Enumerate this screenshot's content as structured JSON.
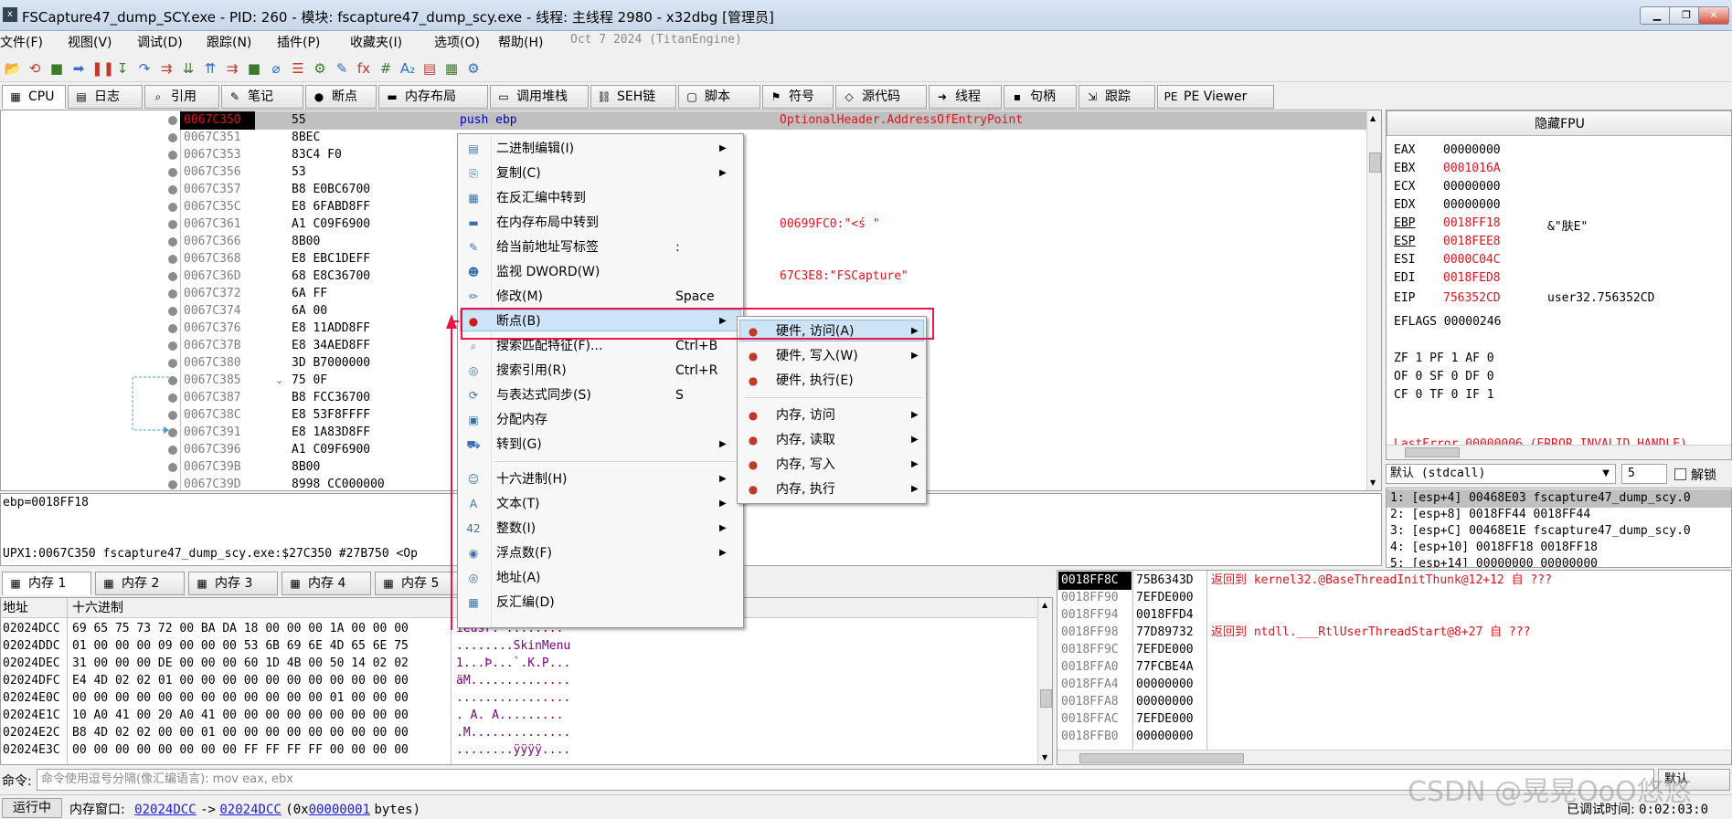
{
  "window": {
    "title": "FSCapture47_dump_SCY.exe - PID: 260 - 模块: fscapture47_dump_scy.exe - 线程: 主线程 2980 - x32dbg [管理员]",
    "min": "▁",
    "max": "❐",
    "close": "✕"
  },
  "menubar": {
    "items": [
      "文件(F)",
      "视图(V)",
      "调试(D)",
      "跟踪(N)",
      "插件(P)",
      "收藏夹(I)",
      "选项(O)",
      "帮助(H)"
    ],
    "build": "Oct 7 2024 (TitanEngine)"
  },
  "toolbar": {
    "icons": [
      "📂",
      "⟲",
      "■",
      "➡",
      "❚❚",
      "↧",
      "↷",
      "⇉",
      "⇊",
      "⇈",
      "⇉",
      "■",
      "⌀",
      "☰",
      "⚙",
      "✎",
      "fx",
      "#",
      "A₂",
      "▤",
      "▦",
      "⚙"
    ]
  },
  "tabs": [
    "CPU",
    "日志",
    "引用",
    "笔记",
    "断点",
    "内存布局",
    "调用堆栈",
    "SEH链",
    "脚本",
    "符号",
    "源代码",
    "线程",
    "句柄",
    "跟踪",
    "PE Viewer"
  ],
  "tab_icons": [
    "▦",
    "▤",
    "⌕",
    "✎",
    "●",
    "▬",
    "▭",
    "⛓",
    "▢",
    "⚑",
    "◇",
    "➜",
    "▪",
    "⇲",
    "PE"
  ],
  "disasm": {
    "rows": [
      {
        "addr": "0067C350",
        "bytes": "55",
        "asm": "push ebp",
        "comment": "OptionalHeader.AddressOfEntryPoint"
      },
      {
        "addr": "0067C351",
        "bytes": "8BEC",
        "asm": "",
        "comment": ""
      },
      {
        "addr": "0067C353",
        "bytes": "83C4 F0",
        "asm": "",
        "comment": ""
      },
      {
        "addr": "0067C356",
        "bytes": "53",
        "asm": "",
        "comment": ""
      },
      {
        "addr": "0067C357",
        "bytes": "B8 E0BC6700",
        "asm": "",
        "comment": ""
      },
      {
        "addr": "0067C35C",
        "bytes": "E8 6FABD8FF",
        "asm": "",
        "comment": ""
      },
      {
        "addr": "0067C361",
        "bytes": "A1 C09F6900",
        "asm": "",
        "comment": "00699FC0:\"<ś \""
      },
      {
        "addr": "0067C366",
        "bytes": "8B00",
        "asm": "",
        "comment": ""
      },
      {
        "addr": "0067C368",
        "bytes": "E8 EBC1DEFF",
        "asm": "",
        "comment": ""
      },
      {
        "addr": "0067C36D",
        "bytes": "68 E8C36700",
        "asm": "",
        "comment": "67C3E8:\"FSCapture\""
      },
      {
        "addr": "0067C372",
        "bytes": "6A FF",
        "asm": "",
        "comment": ""
      },
      {
        "addr": "0067C374",
        "bytes": "6A 00",
        "asm": "",
        "comment": ""
      },
      {
        "addr": "0067C376",
        "bytes": "E8 11ADD8FF",
        "asm": "",
        "comment": ""
      },
      {
        "addr": "0067C37B",
        "bytes": "E8 34AED8FF",
        "asm": "",
        "comment": ""
      },
      {
        "addr": "0067C380",
        "bytes": "3D B7000000",
        "asm": "",
        "comment": ""
      },
      {
        "addr": "0067C385",
        "bytes": "75 0F",
        "asm": "",
        "comment": ""
      },
      {
        "addr": "0067C387",
        "bytes": "B8 FCC36700",
        "asm": "",
        "comment": ""
      },
      {
        "addr": "0067C38C",
        "bytes": "E8 53F8FFFF",
        "asm": "",
        "comment": ""
      },
      {
        "addr": "0067C391",
        "bytes": "E8 1A83D8FF",
        "asm": "",
        "comment": ""
      },
      {
        "addr": "0067C396",
        "bytes": "A1 C09F6900",
        "asm": "",
        "comment": ""
      },
      {
        "addr": "0067C39B",
        "bytes": "8B00",
        "asm": "",
        "comment": ""
      },
      {
        "addr": "0067C39D",
        "bytes": "8998 CC000000",
        "asm": "",
        "comment": ""
      }
    ],
    "jump_marker": "⌄"
  },
  "info": {
    "line1": "ebp=0018FF18",
    "line2": "UPX1:0067C350 fscapture47_dump_scy.exe:$27C350 #27B750 <Op"
  },
  "fpu": {
    "toggle": "隐藏FPU",
    "regs": [
      {
        "n": "EAX",
        "v": "00000000",
        "x": ""
      },
      {
        "n": "EBX",
        "v": "0001016A",
        "x": ""
      },
      {
        "n": "ECX",
        "v": "00000000",
        "x": ""
      },
      {
        "n": "EDX",
        "v": "00000000",
        "x": ""
      },
      {
        "n": "EBP",
        "v": "0018FF18",
        "x": "&\"肤E\""
      },
      {
        "n": "ESP",
        "v": "0018FEE8",
        "x": ""
      },
      {
        "n": "ESI",
        "v": "0000C04C",
        "x": ""
      },
      {
        "n": "EDI",
        "v": "0018FED8",
        "x": ""
      }
    ],
    "eip": {
      "n": "EIP",
      "v": "756352CD",
      "x": "user32.756352CD"
    },
    "eflags": "EFLAGS   00000246",
    "flags": [
      "ZF 1  PF 1  AF 0",
      "OF 0  SF 0  DF 0",
      "CF 0  TF 0  IF 1"
    ],
    "lasterror": "LastError  00000006 (ERROR_INVALID_HANDLE)",
    "callconv": "默认 (stdcall)",
    "argcount": "5",
    "unlock": "解锁",
    "args": [
      "1: [esp+4] 00468E03 fscapture47_dump_scy.0",
      "2: [esp+8] 0018FF44 0018FF44",
      "3: [esp+C] 00468E1E fscapture47_dump_scy.0",
      "4: [esp+10] 0018FF18 0018FF18",
      "5: [esp+14] 00000000 00000000"
    ]
  },
  "dump": {
    "tabs": [
      "内存 1",
      "内存 2",
      "内存 3",
      "内存 4",
      "内存 5"
    ],
    "hdr_addr": "地址",
    "hdr_hex": "十六进制",
    "rows": [
      {
        "a": "02024DCC",
        "h": "69 65 75 73 72 00 BA DA 18 00 00 00 1A 00 00 00",
        "s": "ieusr.  ........"
      },
      {
        "a": "02024DDC",
        "h": "01 00 00 00 09 00 00 00 53 6B 69 6E 4D 65 6E 75",
        "s": "........SkinMenu"
      },
      {
        "a": "02024DEC",
        "h": "31 00 00 00 DE 00 00 00 60 1D 4B 00 50 14 02 02",
        "s": "1...Þ...`.K.P..."
      },
      {
        "a": "02024DFC",
        "h": "E4 4D 02 02 01 00 00 00 00 00 00 00 00 00 00 00",
        "s": "äM.............."
      },
      {
        "a": "02024E0C",
        "h": "00 00 00 00 00 00 00 00 00 00 00 00 01 00 00 00",
        "s": "................"
      },
      {
        "a": "02024E1C",
        "h": "10 A0 41 00 20 A0 41 00 00 00 00 00 00 00 00 00",
        "s": ". A.  A........."
      },
      {
        "a": "02024E2C",
        "h": "B8 4D 02 02 00 00 01 00 00 00 00 00 00 00 00 00",
        "s": ".M.............."
      },
      {
        "a": "02024E3C",
        "h": "00 00 00 00 00 00 00 00 FF FF FF FF 00 00 00 00",
        "s": "........ÿÿÿÿ...."
      }
    ]
  },
  "stack": {
    "rows": [
      {
        "a": "0018FF8C",
        "v": "75B6343D",
        "c": "返回到 kernel32.@BaseThreadInitThunk@12+12 自 ???"
      },
      {
        "a": "0018FF90",
        "v": "7EFDE000",
        "c": ""
      },
      {
        "a": "0018FF94",
        "v": "0018FFD4",
        "c": ""
      },
      {
        "a": "0018FF98",
        "v": "77D89732",
        "c": "返回到 ntdll.___RtlUserThreadStart@8+27 自 ???"
      },
      {
        "a": "0018FF9C",
        "v": "7EFDE000",
        "c": ""
      },
      {
        "a": "0018FFA0",
        "v": "77FCBE4A",
        "c": ""
      },
      {
        "a": "0018FFA4",
        "v": "00000000",
        "c": ""
      },
      {
        "a": "0018FFA8",
        "v": "00000000",
        "c": ""
      },
      {
        "a": "0018FFAC",
        "v": "7EFDE000",
        "c": ""
      },
      {
        "a": "0018FFB0",
        "v": "00000000",
        "c": ""
      }
    ]
  },
  "command": {
    "label": "命令:",
    "placeholder": "命令使用逗号分隔(像汇编语言): mov eax, ebx",
    "default_btn": "默认"
  },
  "status": {
    "state": "运行中",
    "mem_label": "内存窗口:",
    "from": "02024DCC",
    "arrow": "->",
    "to": "02024DCC",
    "size_pre": "(0x",
    "size": "00000001",
    "size_post": "bytes)",
    "time_label": "已调试时间:",
    "time": "0:02:03:0"
  },
  "watermark": "CSDN @晃晃OoO悠悠",
  "context_menu": {
    "items": [
      {
        "label": "二进制编辑(I)",
        "sc": "",
        "sub": true,
        "ic": "▤"
      },
      {
        "label": "复制(C)",
        "sc": "",
        "sub": true,
        "ic": "⎘"
      },
      {
        "label": "在反汇编中转到",
        "sc": "",
        "sub": false,
        "ic": "▦"
      },
      {
        "label": "在内存布局中转到",
        "sc": "",
        "sub": false,
        "ic": "▬"
      },
      {
        "label": "给当前地址写标签",
        "sc": ":",
        "sub": false,
        "ic": "✎"
      },
      {
        "label": "监视 DWORD(W)",
        "sc": "",
        "sub": false,
        "ic": "☻"
      },
      {
        "label": "修改(M)",
        "sc": "Space",
        "sub": false,
        "ic": "✏"
      },
      {
        "label": "断点(B)",
        "sc": "",
        "sub": true,
        "ic": "●"
      },
      {
        "label": "搜索匹配特征(F)...",
        "sc": "Ctrl+B",
        "sub": false,
        "ic": "⌕"
      },
      {
        "label": "搜索引用(R)",
        "sc": "Ctrl+R",
        "sub": false,
        "ic": "◎"
      },
      {
        "label": "与表达式同步(S)",
        "sc": "S",
        "sub": false,
        "ic": "⟳"
      },
      {
        "label": "分配内存",
        "sc": "",
        "sub": false,
        "ic": "▣"
      },
      {
        "label": "转到(G)",
        "sc": "",
        "sub": true,
        "ic": "⛟"
      },
      {
        "label": "十六进制(H)",
        "sc": "",
        "sub": true,
        "ic": "☺"
      },
      {
        "label": "文本(T)",
        "sc": "",
        "sub": true,
        "ic": "A"
      },
      {
        "label": "整数(I)",
        "sc": "",
        "sub": true,
        "ic": "42"
      },
      {
        "label": "浮点数(F)",
        "sc": "",
        "sub": true,
        "ic": "◉"
      },
      {
        "label": "地址(A)",
        "sc": "",
        "sub": false,
        "ic": "◎"
      },
      {
        "label": "反汇编(D)",
        "sc": "",
        "sub": false,
        "ic": "▦"
      }
    ]
  },
  "submenu": {
    "items": [
      {
        "label": "硬件, 访问(A)",
        "sub": true
      },
      {
        "label": "硬件, 写入(W)",
        "sub": true
      },
      {
        "label": "硬件, 执行(E)",
        "sub": false
      },
      {
        "label": "内存, 访问",
        "sub": true
      },
      {
        "label": "内存, 读取",
        "sub": true
      },
      {
        "label": "内存, 写入",
        "sub": true
      },
      {
        "label": "内存, 执行",
        "sub": true
      }
    ]
  }
}
